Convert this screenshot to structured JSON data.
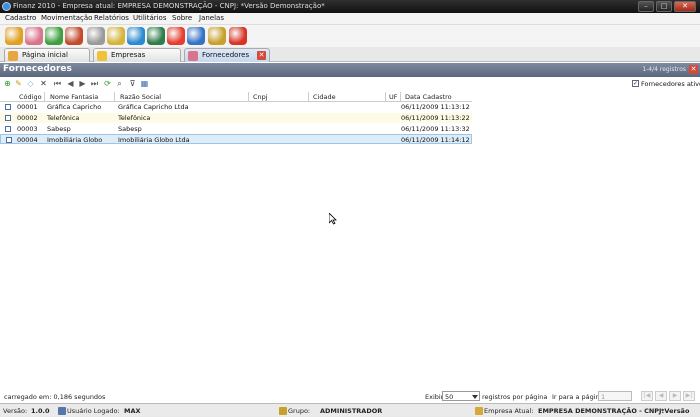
{
  "titlebar": {
    "title": "Finanz 2010 - Empresa atual: EMPRESA DEMONSTRAÇÃO - CNPJ:  *Versão Demonstração*",
    "minimize": "–",
    "maximize": "□",
    "close": "✕"
  },
  "menu": [
    "Cadastro",
    "Movimentação",
    "Relatórios",
    "Utilitários",
    "Sobre",
    "Janelas"
  ],
  "toolbar_icons": [
    {
      "name": "coins-icon",
      "color": "#e0a020"
    },
    {
      "name": "people-icon",
      "color": "#d9748c"
    },
    {
      "name": "globe-arrows-icon",
      "color": "#3ea03e"
    },
    {
      "name": "cash-icon",
      "color": "#c44a2c"
    },
    {
      "name": "pen-icon",
      "color": "#9a9a9a"
    },
    {
      "name": "money-bill-icon",
      "color": "#d6b43a"
    },
    {
      "name": "refresh-money-icon",
      "color": "#2b8ad1"
    },
    {
      "name": "invoice-icon",
      "color": "#2e7d4a"
    },
    {
      "name": "pie-chart-icon",
      "color": "#e63d2e"
    },
    {
      "name": "floppy-disk-icon",
      "color": "#3573c6"
    },
    {
      "name": "keys-icon",
      "color": "#c9a02a"
    },
    {
      "name": "power-icon",
      "color": "#d83325"
    }
  ],
  "tabs": [
    {
      "label": "Página inicial",
      "icon": "home-icon",
      "active": false
    },
    {
      "label": "Empresas",
      "icon": "star-icon",
      "active": false
    },
    {
      "label": "Fornecedores",
      "icon": "people-icon",
      "active": true
    }
  ],
  "panel": {
    "title": "Fornecedores",
    "count": "1-4/4 registros",
    "close": "✕"
  },
  "grid_toolbar": [
    "add-icon",
    "edit-icon",
    "erase-icon",
    "delete-icon",
    "first-icon",
    "prev-icon",
    "next-icon",
    "last-icon",
    "refresh-icon",
    "search-icon",
    "filter-icon",
    "export-icon"
  ],
  "filter": {
    "label": "Fornecedores ativos",
    "checked": true
  },
  "columns": [
    "Código",
    "Nome Fantasia",
    "Razão Social",
    "Cnpj",
    "Cidade",
    "UF",
    "Data Cadastro"
  ],
  "rows": [
    {
      "codigo": "00001",
      "fantasia": "Gráfica Capricho",
      "razao": "Gráfica Capricho Ltda",
      "cnpj": "",
      "cidade": "",
      "uf": "",
      "data": "06/11/2009 11:13:12"
    },
    {
      "codigo": "00002",
      "fantasia": "Telefônica",
      "razao": "Telefônica",
      "cnpj": "",
      "cidade": "",
      "uf": "",
      "data": "06/11/2009 11:13:22"
    },
    {
      "codigo": "00003",
      "fantasia": "Sabesp",
      "razao": "Sabesp",
      "cnpj": "",
      "cidade": "",
      "uf": "",
      "data": "06/11/2009 11:13:32"
    },
    {
      "codigo": "00004",
      "fantasia": "Imobiliária Globo",
      "razao": "Imobiliária Globo Ltda",
      "cnpj": "",
      "cidade": "",
      "uf": "",
      "data": "06/11/2009 11:14:12"
    }
  ],
  "footer": {
    "loaded": "carregado em: 0,186 segundos",
    "exibir": "Exibir",
    "per_page_value": "50",
    "per_page_label": "registros por página",
    "goto_label": "Ir para a página",
    "goto_value": "1"
  },
  "statusbar": {
    "version_label": "Versão:",
    "version": "1.0.0",
    "user_label": "Usuário Logado:",
    "user": "MAX",
    "group_label": "Grupo:",
    "group": "ADMINISTRADOR",
    "company_label": "Empresa Atual:",
    "company": "EMPRESA DEMONSTRAÇÃO - CNPJ:",
    "company_suffix": "*Versão"
  }
}
